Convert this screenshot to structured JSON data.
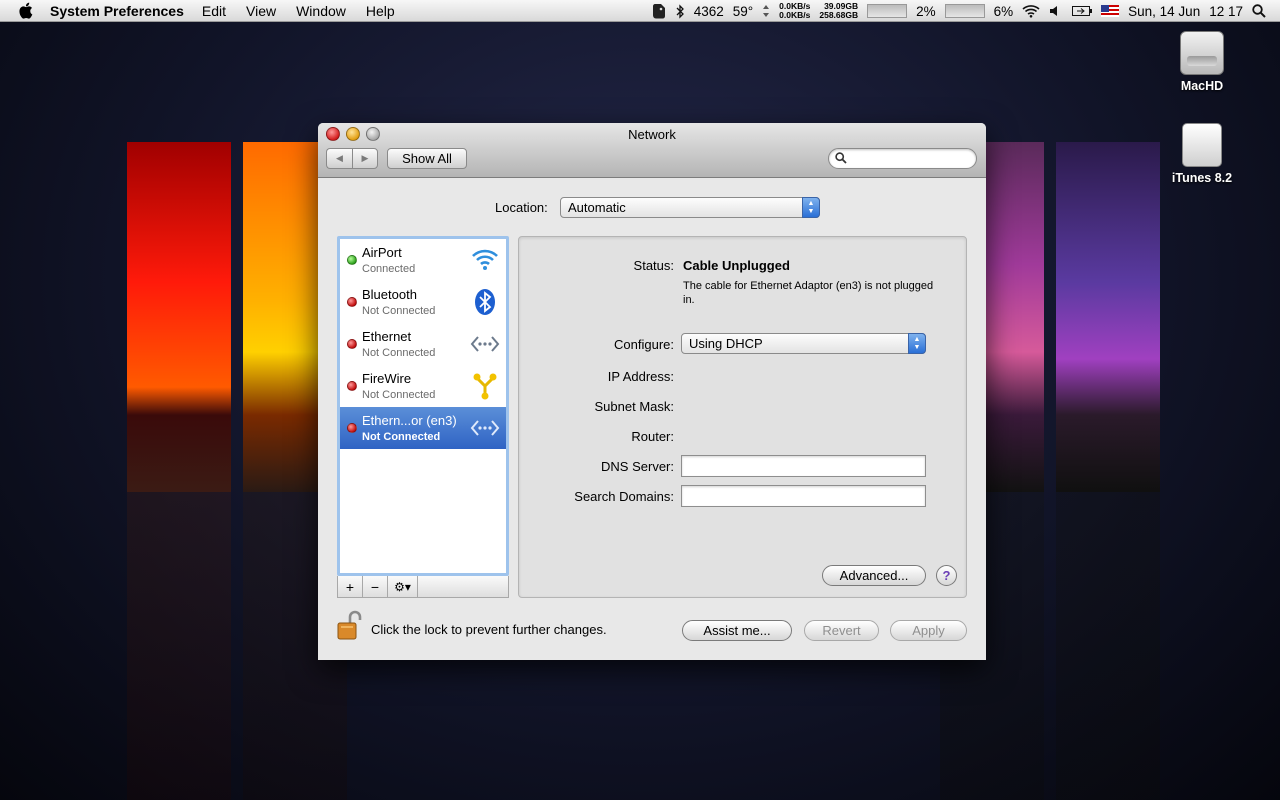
{
  "menubar": {
    "app_name": "System Preferences",
    "menus": [
      "Edit",
      "View",
      "Window",
      "Help"
    ],
    "status": {
      "memory": "4362",
      "temperature": "59°",
      "net_in": "0.0KB/s",
      "net_out": "0.0KB/s",
      "disk_1": "39.09GB",
      "disk_2": "258.68GB",
      "cpu_1": "2%",
      "cpu_2": "6%",
      "date": "Sun, 14 Jun",
      "time": "12 17"
    }
  },
  "desktop": {
    "icons": [
      {
        "label": "MacHD",
        "icon": "hard-drive-icon"
      },
      {
        "label": "iTunes 8.2",
        "icon": "ipod-disk-icon"
      }
    ]
  },
  "window": {
    "title": "Network",
    "toolbar": {
      "show_all_label": "Show All",
      "search_placeholder": ""
    },
    "location": {
      "label": "Location:",
      "value": "Automatic"
    },
    "services": [
      {
        "name": "AirPort",
        "status": "Connected",
        "state": "green",
        "icon": "airport-wifi-icon",
        "selected": false
      },
      {
        "name": "Bluetooth",
        "status": "Not Connected",
        "state": "red",
        "icon": "bluetooth-icon",
        "selected": false
      },
      {
        "name": "Ethernet",
        "status": "Not Connected",
        "state": "red",
        "icon": "ethernet-icon",
        "selected": false
      },
      {
        "name": "FireWire",
        "status": "Not Connected",
        "state": "red",
        "icon": "firewire-icon",
        "selected": false
      },
      {
        "name": "Ethern...or (en3)",
        "status": "Not Connected",
        "state": "red",
        "icon": "ethernet-icon",
        "selected": true
      }
    ],
    "list_tools": {
      "add": "+",
      "remove": "−",
      "gear": "⚙▾"
    },
    "detail": {
      "status_label": "Status:",
      "status_value": "Cable Unplugged",
      "status_description": "The cable for Ethernet Adaptor (en3) is not plugged in.",
      "configure_label": "Configure:",
      "configure_value": "Using DHCP",
      "ip_label": "IP Address:",
      "subnet_label": "Subnet Mask:",
      "router_label": "Router:",
      "dns_label": "DNS Server:",
      "dns_value": "",
      "search_domains_label": "Search Domains:",
      "search_domains_value": "",
      "advanced_label": "Advanced...",
      "help_label": "?"
    },
    "footer": {
      "lock_text": "Click the lock to prevent further changes.",
      "assist_label": "Assist me...",
      "revert_label": "Revert",
      "apply_label": "Apply"
    }
  }
}
